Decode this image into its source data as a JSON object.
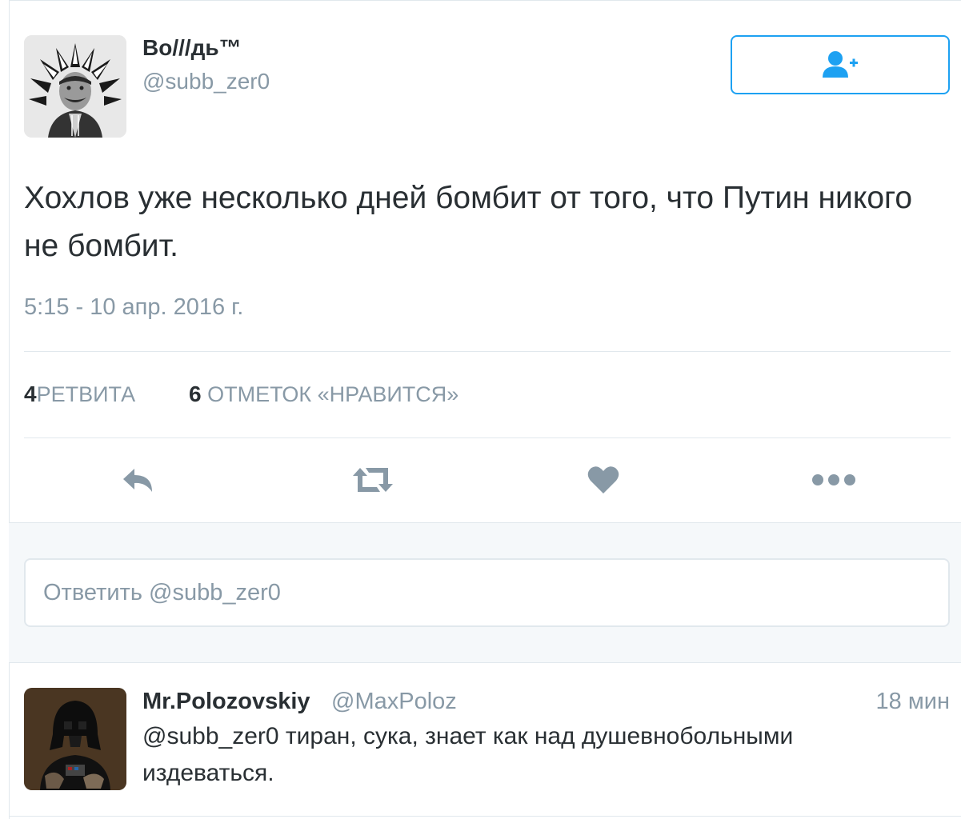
{
  "tweet": {
    "author_name": "Во///дь™",
    "author_handle": "@subb_zer0",
    "text": "Хохлов уже несколько дней бомбит от того, что Путин никого не бомбит.",
    "time": "5:15 - 10 апр. 2016 г.",
    "retweets_count": "4",
    "retweets_label": "РЕТВИТА",
    "likes_count": "6",
    "likes_label": "ОТМЕТОК «НРАВИТСЯ»"
  },
  "icons": {
    "follow": "person-plus-icon",
    "reply": "reply-icon",
    "retweet": "retweet-icon",
    "like": "heart-icon",
    "more": "more-dots-icon"
  },
  "reply_box": {
    "placeholder": "Ответить @subb_zer0"
  },
  "reply": {
    "author_name": "Mr.Polozovskiy",
    "author_handle": "@MaxPoloz",
    "time": "18 мин",
    "text": "@subb_zer0 тиран, сука, знает как над душевнобольными издеваться."
  },
  "colors": {
    "accent": "#1da1f2",
    "muted": "#8899a6",
    "text": "#292f33",
    "border": "#e1e8ed",
    "reply_bg": "#f5f8fa"
  }
}
